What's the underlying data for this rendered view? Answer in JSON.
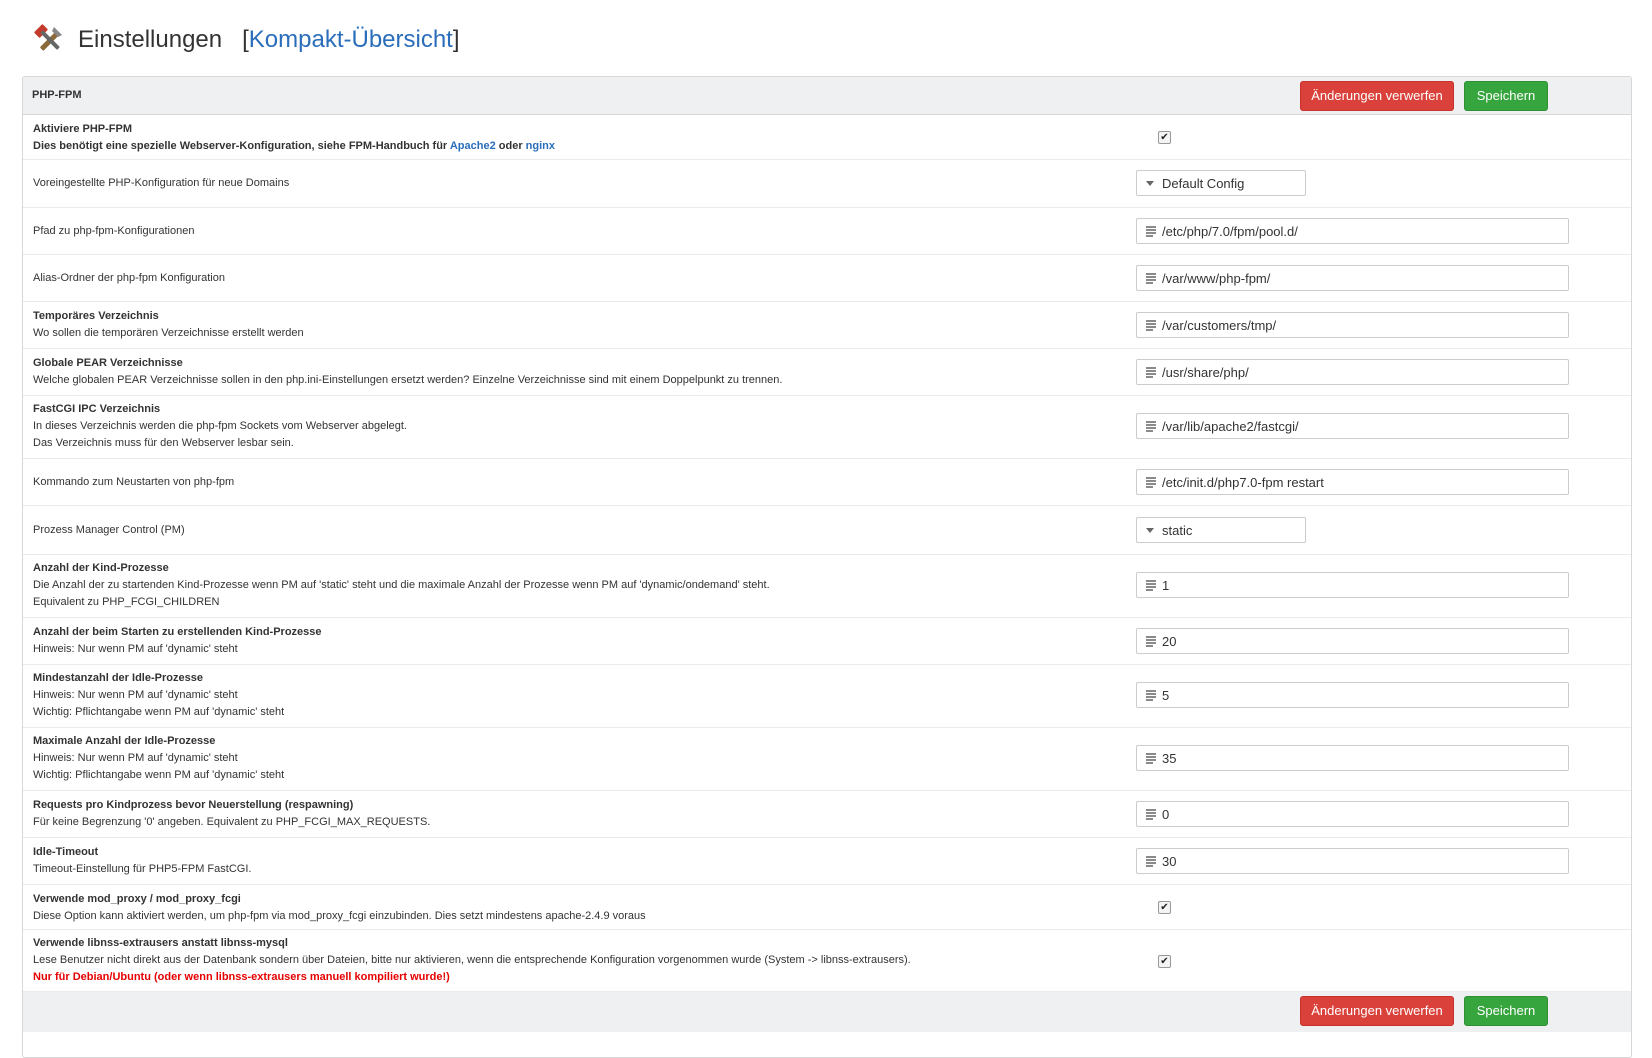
{
  "header": {
    "title": "Einstellungen",
    "bracket_open": "[",
    "link": "Kompakt-Übersicht",
    "bracket_close": "]",
    "icon": "tools-icon"
  },
  "panel": {
    "title": "PHP-FPM",
    "discard_label": "Änderungen verwerfen",
    "save_label": "Speichern"
  },
  "rows": [
    {
      "title": "Aktiviere PHP-FPM",
      "desc_pre": "Dies benötigt eine spezielle Webserver-Konfiguration, siehe FPM-Handbuch für ",
      "link1": "Apache2",
      "mid": " oder ",
      "link2": "nginx",
      "type": "checkbox",
      "checked": true
    },
    {
      "title": "",
      "label": "Voreingestellte PHP-Konfiguration für neue Domains",
      "type": "select",
      "value": "Default Config"
    },
    {
      "label": "Pfad zu php-fpm-Konfigurationen",
      "type": "text",
      "value": "/etc/php/7.0/fpm/pool.d/"
    },
    {
      "label": "Alias-Ordner der php-fpm Konfiguration",
      "type": "text",
      "value": "/var/www/php-fpm/"
    },
    {
      "title": "Temporäres Verzeichnis",
      "desc1": "Wo sollen die temporären Verzeichnisse erstellt werden",
      "type": "text",
      "value": "/var/customers/tmp/"
    },
    {
      "title": "Globale PEAR Verzeichnisse",
      "desc1": "Welche globalen PEAR Verzeichnisse sollen in den php.ini-Einstellungen ersetzt werden? Einzelne Verzeichnisse sind mit einem Doppelpunkt zu trennen.",
      "type": "text",
      "value": "/usr/share/php/"
    },
    {
      "title": "FastCGI IPC Verzeichnis",
      "desc1": "In dieses Verzeichnis werden die php-fpm Sockets vom Webserver abgelegt.",
      "desc2": "Das Verzeichnis muss für den Webserver lesbar sein.",
      "type": "text",
      "value": "/var/lib/apache2/fastcgi/"
    },
    {
      "label": "Kommando zum Neustarten von php-fpm",
      "type": "text",
      "value": "/etc/init.d/php7.0-fpm restart"
    },
    {
      "label": "Prozess Manager Control (PM)",
      "type": "select",
      "value": "static"
    },
    {
      "title": "Anzahl der Kind-Prozesse",
      "desc1": "Die Anzahl der zu startenden Kind-Prozesse wenn PM auf 'static' steht und die maximale Anzahl der Prozesse wenn PM auf 'dynamic/ondemand' steht.",
      "desc2": "Equivalent zu PHP_FCGI_CHILDREN",
      "type": "text",
      "value": "1"
    },
    {
      "title": "Anzahl der beim Starten zu erstellenden Kind-Prozesse",
      "desc1": "Hinweis: Nur wenn PM auf 'dynamic' steht",
      "type": "text",
      "value": "20"
    },
    {
      "title": "Mindestanzahl der Idle-Prozesse",
      "desc1": "Hinweis: Nur wenn PM auf 'dynamic' steht",
      "desc2": "Wichtig: Pflichtangabe wenn PM auf 'dynamic' steht",
      "type": "text",
      "value": "5"
    },
    {
      "title": "Maximale Anzahl der Idle-Prozesse",
      "desc1": "Hinweis: Nur wenn PM auf 'dynamic' steht",
      "desc2": "Wichtig: Pflichtangabe wenn PM auf 'dynamic' steht",
      "type": "text",
      "value": "35"
    },
    {
      "title": "Requests pro Kindprozess bevor Neuerstellung (respawning)",
      "desc1": "Für keine Begrenzung '0' angeben. Equivalent zu PHP_FCGI_MAX_REQUESTS.",
      "type": "text",
      "value": "0"
    },
    {
      "title": "Idle-Timeout",
      "desc1": "Timeout-Einstellung für PHP5-FPM FastCGI.",
      "type": "text",
      "value": "30"
    },
    {
      "title": "Verwende mod_proxy / mod_proxy_fcgi",
      "desc1": "Diese Option kann aktiviert werden, um php-fpm via mod_proxy_fcgi einzubinden. Dies setzt mindestens apache-2.4.9 voraus",
      "type": "checkbox",
      "checked": true
    },
    {
      "title": "Verwende libnss-extrausers anstatt libnss-mysql",
      "desc1": "Lese Benutzer nicht direkt aus der Datenbank sondern über Dateien, bitte nur aktivieren, wenn die entsprechende Konfiguration vorgenommen wurde (System -> libnss-extrausers).",
      "warn": "Nur für Debian/Ubuntu (oder wenn libnss-extrausers manuell kompiliert wurde!)",
      "type": "checkbox",
      "checked": true
    }
  ],
  "check_mark": "✔"
}
